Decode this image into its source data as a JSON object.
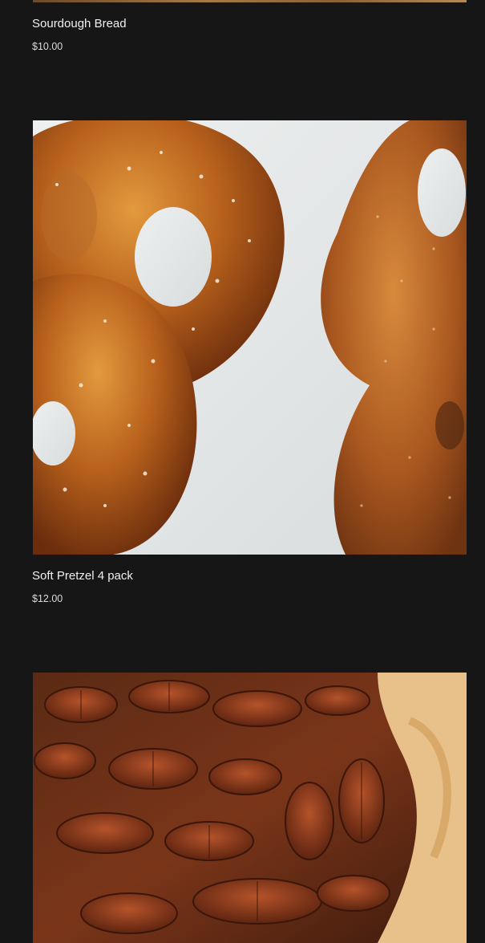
{
  "products": [
    {
      "name": "Sourdough Bread",
      "price": "$10.00",
      "image": "sourdough-bread-photo"
    },
    {
      "name": "Soft Pretzel 4 pack",
      "price": "$12.00",
      "image": "soft-pretzel-photo"
    },
    {
      "name": "",
      "price": "",
      "image": "pecan-pie-photo"
    }
  ],
  "colors": {
    "background": "#161616",
    "text": "#f0f0f0",
    "price": "#dcdcdc"
  }
}
